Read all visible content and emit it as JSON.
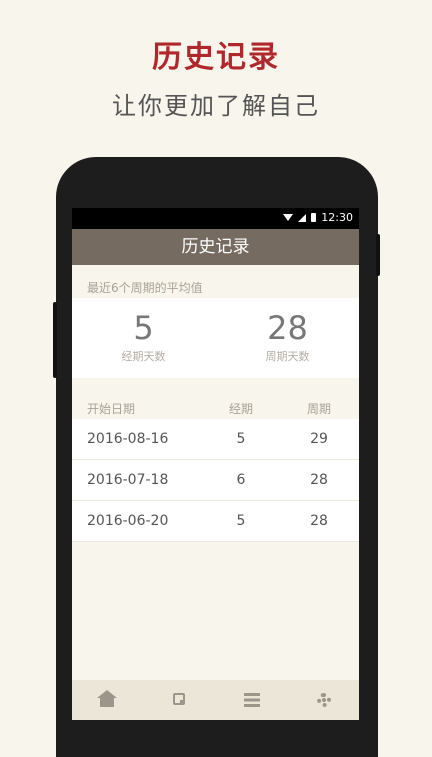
{
  "promo": {
    "title": "历史记录",
    "subtitle": "让你更加了解自己"
  },
  "statusbar": {
    "time": "12:30",
    "icons": [
      "wifi-icon",
      "signal-icon",
      "battery-icon"
    ]
  },
  "appbar": {
    "title": "历史记录"
  },
  "averages": {
    "label": "最近6个周期的平均值",
    "period_days": {
      "value": "5",
      "label": "经期天数"
    },
    "cycle_days": {
      "value": "28",
      "label": "周期天数"
    }
  },
  "history_table": {
    "headers": {
      "start_date": "开始日期",
      "period": "经期",
      "cycle": "周期"
    },
    "rows": [
      {
        "start_date": "2016-08-16",
        "period": "5",
        "cycle": "29"
      },
      {
        "start_date": "2016-07-18",
        "period": "6",
        "cycle": "28"
      },
      {
        "start_date": "2016-06-20",
        "period": "5",
        "cycle": "28"
      }
    ]
  },
  "tabbar": {
    "icons": [
      "home-icon",
      "calendar-icon",
      "list-icon",
      "settings-icon"
    ]
  },
  "colors": {
    "accent_red": "#b0282c",
    "appbar": "#756b60",
    "background": "#f8f5ec"
  }
}
